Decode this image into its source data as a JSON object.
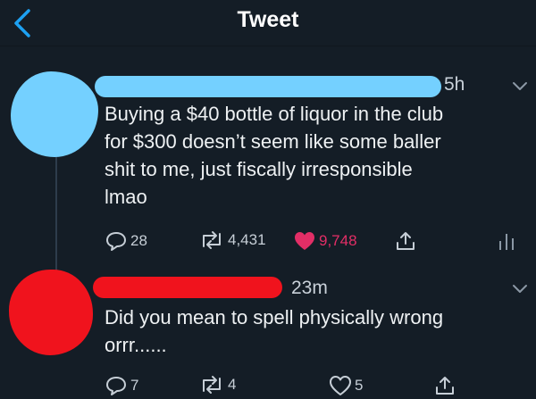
{
  "navbar": {
    "title": "Tweet"
  },
  "tweets": [
    {
      "timestamp": "5h",
      "text_lines": [
        "Buying a $40 bottle of liquor in the club",
        "for $300 doesn’t seem like some baller",
        "shit to me, just fiscally irresponsible",
        "lmao"
      ],
      "replies": "28",
      "retweets": "4,431",
      "likes": "9,748",
      "liked": true,
      "avatar_color": "#74d0ff"
    },
    {
      "timestamp": "23m",
      "text_lines": [
        "Did you mean to spell physically wrong",
        "orrr......"
      ],
      "replies": "7",
      "retweets": "4",
      "likes": "5",
      "liked": false,
      "avatar_color": "#f0131d"
    }
  ],
  "icons": [
    "back-chevron-icon",
    "caret-down-icon",
    "reply-icon",
    "retweet-icon",
    "heart-icon",
    "share-icon",
    "analytics-icon"
  ],
  "colors": {
    "background": "#141d26",
    "accent": "#1da1f2",
    "like": "#e22e66"
  }
}
